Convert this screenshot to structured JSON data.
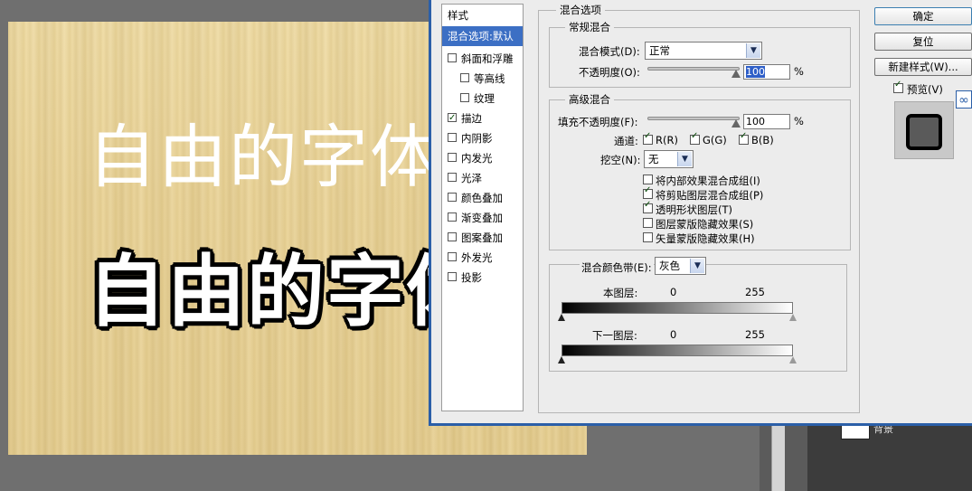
{
  "canvas": {
    "line1": "自由的字体",
    "line2": "自由的字体"
  },
  "background_layer": {
    "name": "背景"
  },
  "style_list": {
    "header": "样式",
    "items": [
      {
        "label": "混合选项:默认",
        "selected": true,
        "has_checkbox": false
      },
      {
        "label": "斜面和浮雕",
        "checked": false
      },
      {
        "label": "等高线",
        "checked": false,
        "indent": true
      },
      {
        "label": "纹理",
        "checked": false,
        "indent": true
      },
      {
        "label": "描边",
        "checked": true
      },
      {
        "label": "内阴影",
        "checked": false
      },
      {
        "label": "内发光",
        "checked": false
      },
      {
        "label": "光泽",
        "checked": false
      },
      {
        "label": "颜色叠加",
        "checked": false
      },
      {
        "label": "渐变叠加",
        "checked": false
      },
      {
        "label": "图案叠加",
        "checked": false
      },
      {
        "label": "外发光",
        "checked": false
      },
      {
        "label": "投影",
        "checked": false
      }
    ]
  },
  "blend_options": {
    "title": "混合选项",
    "general": {
      "title": "常规混合",
      "mode_label": "混合模式(D):",
      "mode_value": "正常",
      "opacity_label": "不透明度(O):",
      "opacity_value": "100",
      "opacity_unit": "%"
    },
    "advanced": {
      "title": "高级混合",
      "fill_label": "填充不透明度(F):",
      "fill_value": "100",
      "fill_unit": "%",
      "channels_label": "通道:",
      "channel_r": "R(R)",
      "channel_g": "G(G)",
      "channel_b": "B(B)",
      "knockout_label": "挖空(N):",
      "knockout_value": "无",
      "options": [
        {
          "label": "将内部效果混合成组(I)",
          "checked": false
        },
        {
          "label": "将剪贴图层混合成组(P)",
          "checked": true
        },
        {
          "label": "透明形状图层(T)",
          "checked": true
        },
        {
          "label": "图层蒙版隐藏效果(S)",
          "checked": false
        },
        {
          "label": "矢量蒙版隐藏效果(H)",
          "checked": false
        }
      ]
    },
    "blend_if": {
      "label": "混合颜色带(E):",
      "value": "灰色",
      "this_layer_label": "本图层:",
      "this_low": "0",
      "this_high": "255",
      "under_layer_label": "下一图层:",
      "under_low": "0",
      "under_high": "255"
    }
  },
  "buttons": {
    "ok": "确定",
    "reset": "复位",
    "new_style": "新建样式(W)...",
    "preview_label": "预览(V)"
  }
}
